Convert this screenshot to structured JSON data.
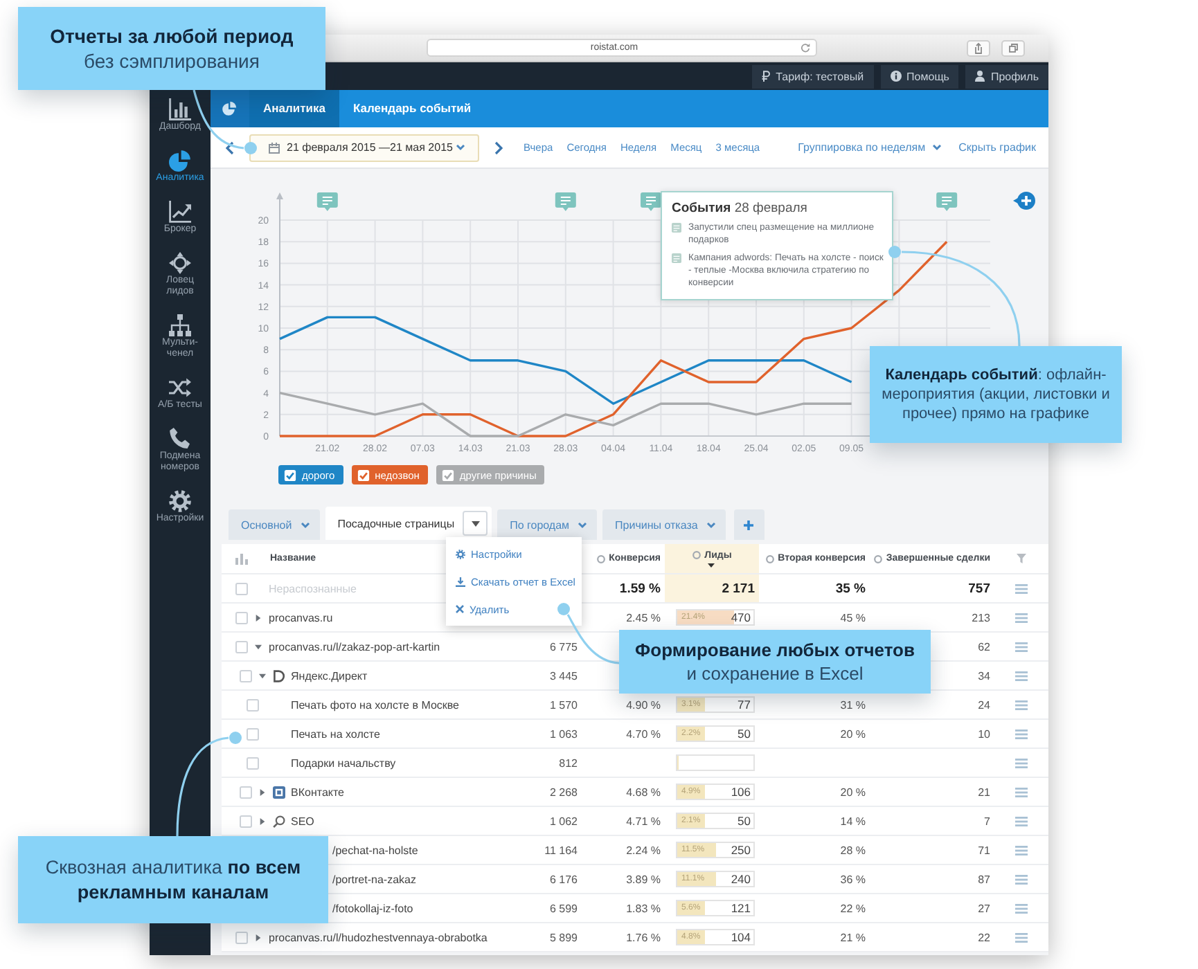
{
  "browser": {
    "address": "roistat.com"
  },
  "top_bar": {
    "buttons": [
      {
        "kind": "tariff",
        "label": "Тариф: тестовый"
      },
      {
        "kind": "help",
        "label": "Помощь"
      },
      {
        "kind": "profile",
        "label": "Профиль"
      }
    ]
  },
  "sidebar": {
    "items": [
      {
        "kind": "dashboard",
        "label": "Дашборд",
        "selected": false
      },
      {
        "kind": "analytics",
        "label": "Аналитика",
        "selected": true
      },
      {
        "kind": "broker",
        "label": "Брокер",
        "selected": false
      },
      {
        "kind": "leads",
        "label": "Ловец лидов",
        "selected": false
      },
      {
        "kind": "multichannel",
        "label": "Мульти-ченел",
        "selected": false
      },
      {
        "kind": "ab",
        "label": "А/Б тесты",
        "selected": false
      },
      {
        "kind": "calls",
        "label": "Подмена номеров",
        "selected": false
      },
      {
        "kind": "settings",
        "label": "Настройки",
        "selected": false
      }
    ]
  },
  "nav": {
    "tabs": [
      {
        "label": "Аналитика",
        "selected": true
      },
      {
        "label": "Календарь событий",
        "selected": false
      }
    ]
  },
  "toolbar": {
    "date_range": "21 февраля 2015 —21 мая 2015",
    "quick_ranges": [
      "Вчера",
      "Сегодня",
      "Неделя",
      "Месяц",
      "3 месяца"
    ],
    "grouping": "Группировка по неделям",
    "hide_chart": "Скрыть график"
  },
  "chart": {
    "chart_data": {
      "type": "line",
      "categories": [
        null,
        "21.02",
        "28.02",
        "07.03",
        "14.03",
        "21.03",
        "28.03",
        "04.04",
        "11.04",
        "18.04",
        "25.04",
        "02.05",
        "09.05",
        null,
        null
      ],
      "ylim": [
        0,
        20
      ],
      "yticks": [
        0,
        2,
        4,
        6,
        8,
        10,
        12,
        14,
        16,
        18,
        20
      ],
      "grid": true,
      "series": [
        {
          "name": "дорого",
          "color": "#1f86c6",
          "values": [
            9,
            11,
            11,
            9,
            7,
            7,
            6,
            3,
            5,
            7,
            7,
            7,
            5,
            null,
            null
          ]
        },
        {
          "name": "недозвон",
          "color": "#e0622c",
          "values": [
            0,
            0,
            0,
            2,
            2,
            0,
            0,
            2,
            7,
            5,
            5,
            9,
            10,
            13.5,
            18
          ]
        },
        {
          "name": "другие причины",
          "color": "#a9abad",
          "values": [
            4,
            3,
            2,
            3,
            0,
            0,
            2,
            1,
            3,
            3,
            2,
            3,
            3,
            null,
            null
          ]
        }
      ]
    },
    "legend": [
      {
        "checked": true
      },
      {
        "checked": true
      },
      {
        "checked": true
      }
    ],
    "tooltip": {
      "title": "**События** 28 февраля",
      "items": [
        "Запустили спец размещение на миллионе подарков",
        "Кампания adwords: Печать на холсте - поиск - теплые -Москва включила стратегию по конверсии"
      ]
    }
  },
  "report_tabs": {
    "tabs": [
      {
        "label": "Основной",
        "selected": false
      },
      {
        "label": "Посадочные страницы",
        "selected": true
      },
      {
        "label": "По городам",
        "selected": false
      },
      {
        "label": "Причины отказа",
        "selected": false
      }
    ],
    "menu": {
      "items": [
        {
          "kind": "settings",
          "label": "Настройки"
        },
        {
          "kind": "download",
          "label": "Скачать отчет в Excel"
        },
        {
          "kind": "delete",
          "label": "Удалить"
        }
      ]
    }
  },
  "table": {
    "columns": [
      {
        "label": "Название",
        "sorted": false
      },
      {
        "label": "Конверсия",
        "sorted": false
      },
      {
        "label": "Лиды",
        "sorted": true
      },
      {
        "label": "Вторая конверсия",
        "sorted": false
      },
      {
        "label": "Завершенные сделки",
        "sorted": false
      }
    ],
    "total": {
      "name": "Нераспознанные",
      "checked": false,
      "conversion": "1.59 %",
      "leads": "2 171",
      "second_conversion": "35 %",
      "deals": "757"
    },
    "rows": [
      {
        "kind": "page",
        "name": "procanvas.ru",
        "checked": false,
        "expanded": false,
        "conversion": "2.45 %",
        "leads": {
          "share": "21.4%",
          "value": "470",
          "level": 0.75
        },
        "second_conversion": "45 %",
        "deals": "213"
      },
      {
        "kind": "page",
        "name": "procanvas.ru/l/zakaz-pop-art-kartin",
        "checked": false,
        "expanded": true,
        "column_2": "6 775",
        "deals": "62",
        "children": [
          {
            "kind": "direct",
            "name": "Яндекс.Директ",
            "checked": false,
            "expanded": true,
            "column_2": "3 445",
            "deals": "34",
            "children": [
              {
                "name": "Печать фото на холсте в Москве",
                "checked": false,
                "column_2": "1 570",
                "conversion": "4.90 %",
                "leads": {
                  "share": "3.1%",
                  "value": "77",
                  "level": 0.36
                },
                "second_conversion": "31 %",
                "deals": "24"
              },
              {
                "name": "Печать на холсте",
                "checked": false,
                "column_2": "1 063",
                "conversion": "4.70 %",
                "leads": {
                  "share": "2.2%",
                  "value": "50",
                  "level": 0.36
                },
                "second_conversion": "20 %",
                "deals": "10"
              },
              {
                "name": "Подарки начальству",
                "checked": false,
                "column_2": "812",
                "leads": {
                  "level": 0
                }
              }
            ]
          },
          {
            "kind": "social",
            "name": "ВКонтакте",
            "checked": false,
            "expanded": false,
            "column_2": "2 268",
            "conversion": "4.68 %",
            "leads": {
              "share": "4.9%",
              "value": "106",
              "level": 0.36
            },
            "second_conversion": "20 %",
            "deals": "21"
          },
          {
            "kind": "search",
            "name": "SEO",
            "checked": false,
            "expanded": false,
            "column_2": "1 062",
            "conversion": "4.71 %",
            "leads": {
              "share": "2.1%",
              "value": "50",
              "level": 0.36
            },
            "second_conversion": "14 %",
            "deals": "7"
          }
        ]
      },
      {
        "kind": "covered",
        "name": "/pechat-na-holste",
        "column_2": "11 164",
        "conversion": "2.24 %",
        "leads": {
          "share": "11.5%",
          "value": "250",
          "level": 0.5
        },
        "second_conversion": "28 %",
        "deals": "71"
      },
      {
        "kind": "covered",
        "name": "/portret-na-zakaz",
        "column_2": "6 176",
        "conversion": "3.89 %",
        "leads": {
          "share": "11.1%",
          "value": "240",
          "level": 0.5
        },
        "second_conversion": "36 %",
        "deals": "87"
      },
      {
        "kind": "covered",
        "name": "/fotokollaj-iz-foto",
        "column_2": "6 599",
        "conversion": "1.83 %",
        "leads": {
          "share": "5.6%",
          "value": "121",
          "level": 0.36
        },
        "second_conversion": "22 %",
        "deals": "27"
      },
      {
        "kind": "page",
        "name": "procanvas.ru/l/hudozhestvennaya-obrabotka",
        "checked": false,
        "expanded": false,
        "column_2": "5 899",
        "conversion": "1.76 %",
        "leads": {
          "share": "4.8%",
          "value": "104",
          "level": 0.36
        },
        "second_conversion": "21 %",
        "deals": "22"
      }
    ]
  },
  "callouts": [
    {
      "title": "Отчеты за любой период",
      "text": "без сэмплирования"
    },
    {
      "text": "**Календарь событий**: офлайн-мероприятия (акции, листовки и прочее) прямо на графике"
    },
    {
      "title": "Формирование любых отчетов",
      "text": "и сохранение в Excel"
    },
    {
      "text": "Сквозная аналитика **по всем рекламным каналам**"
    }
  ]
}
